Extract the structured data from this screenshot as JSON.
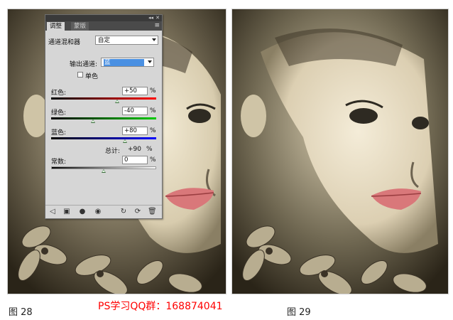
{
  "captions": {
    "left": "图 28",
    "right": "图 29",
    "watermark": "PS学习QQ群：168874041"
  },
  "panel": {
    "tabs": [
      "调整",
      "蒙版"
    ],
    "preset_label": "通道混和器",
    "preset_value": "自定",
    "output_channel_label": "输出通道:",
    "output_channel_value": "蓝",
    "monochrome_label": "单色",
    "monochrome_checked": false,
    "red": {
      "label": "红色:",
      "value": "+50",
      "unit": "%",
      "level": 50
    },
    "green": {
      "label": "绿色:",
      "value": "-40",
      "unit": "%",
      "level": -40
    },
    "blue": {
      "label": "蓝色:",
      "value": "+80",
      "unit": "%",
      "level": 80
    },
    "total": {
      "label": "总计:",
      "value": "+90",
      "unit": "%"
    },
    "constant": {
      "label": "常数:",
      "value": "0",
      "unit": "%",
      "level": 0
    },
    "bottom_icons": [
      "back-arrow-icon",
      "clip-layer-icon",
      "visibility-eye-icon",
      "view-previous-icon",
      "reset-icon",
      "delete-icon"
    ]
  },
  "colors": {
    "sepia_light": "#e8dcc0",
    "sepia_dark": "#2a2418",
    "lip": "#d9787a",
    "watermark": "#ff0000"
  }
}
